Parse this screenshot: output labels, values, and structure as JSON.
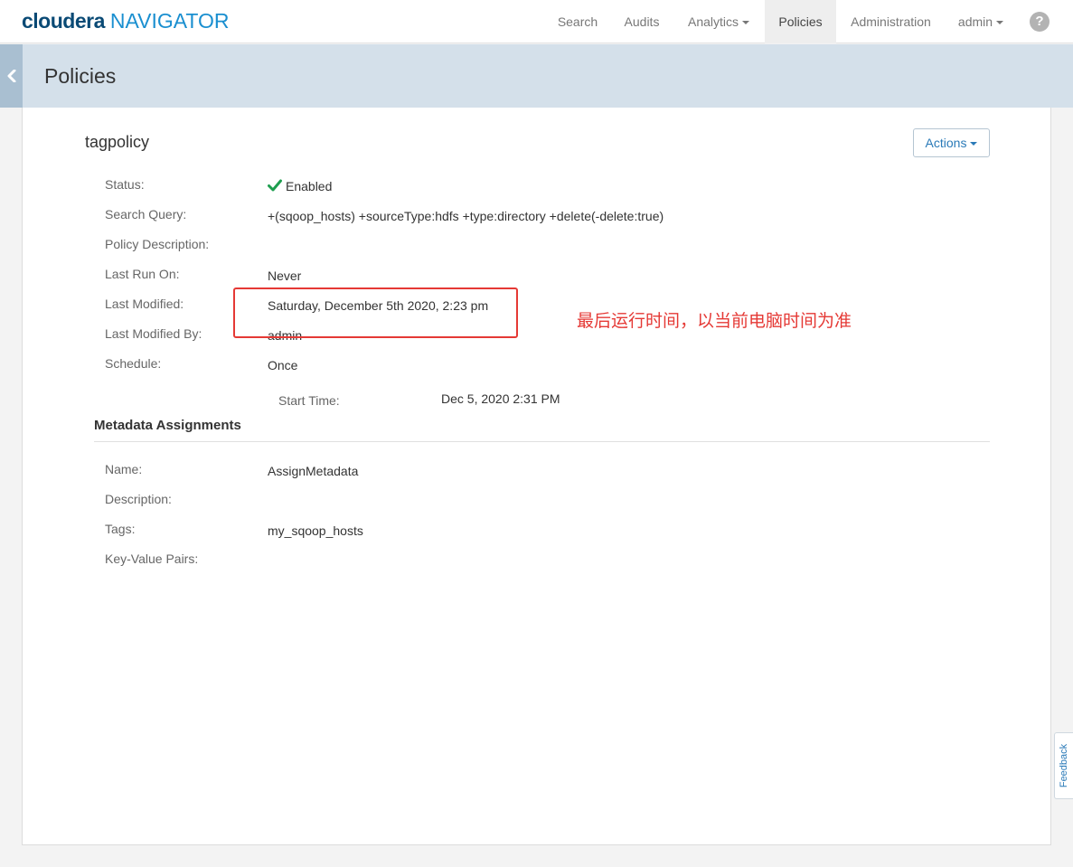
{
  "header": {
    "brand": "cloudera",
    "product": "NAVIGATOR",
    "nav": [
      "Search",
      "Audits",
      "Analytics",
      "Policies",
      "Administration",
      "admin"
    ],
    "help": "?"
  },
  "page": {
    "title": "Policies"
  },
  "policy": {
    "name": "tagpolicy",
    "actions_label": "Actions",
    "fields": [
      {
        "label": "Status:",
        "value": "Enabled"
      },
      {
        "label": "Search Query:",
        "value": "+(sqoop_hosts) +sourceType:hdfs +type:directory +delete(-delete:true)"
      },
      {
        "label": "Policy Description:",
        "value": ""
      },
      {
        "label": "Last Run On:",
        "value": "Never"
      },
      {
        "label": "Last Modified:",
        "value": "Saturday, December 5th 2020, 2:23 pm"
      },
      {
        "label": "Last Modified By:",
        "value": "admin"
      },
      {
        "label": "Schedule:",
        "value": "Once"
      }
    ],
    "start_time": {
      "label": "Start Time:",
      "value": "Dec 5, 2020 2:31 PM"
    }
  },
  "metadata": {
    "title": "Metadata Assignments",
    "fields": [
      {
        "label": "Name:",
        "value": "AssignMetadata"
      },
      {
        "label": "Description:",
        "value": ""
      },
      {
        "label": "Tags:",
        "value": "my_sqoop_hosts"
      },
      {
        "label": "Key-Value Pairs:",
        "value": ""
      }
    ]
  },
  "annotation": {
    "note": "最后运行时间，以当前电脑时间为准"
  },
  "feedback": {
    "label": "Feedback"
  },
  "colors": {
    "status_ok": "#1e9e4f",
    "annotation": "#e53935",
    "link": "#2a7ab8"
  }
}
